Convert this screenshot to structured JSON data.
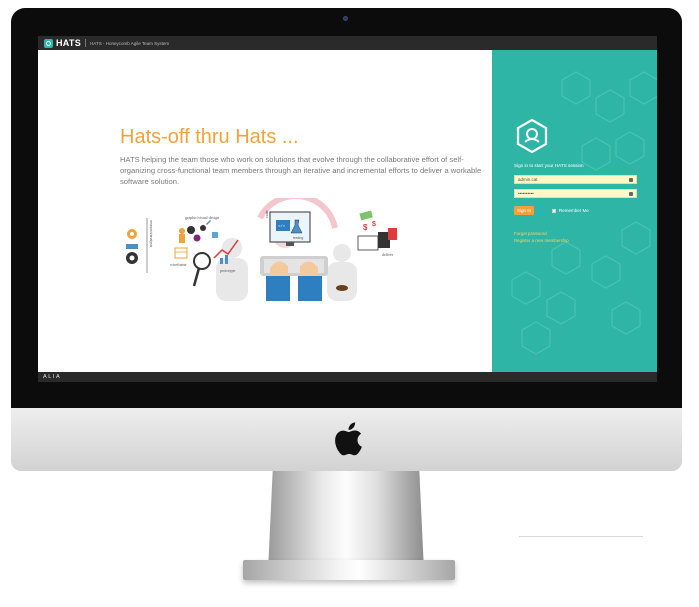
{
  "topbar": {
    "logo_text": "HATS",
    "subtitle": "HATS - Honeycomb Agile Team System"
  },
  "hero": {
    "title": "Hats-off thru Hats ...",
    "description": "HATS helping the team those who work on solutions that evolve through the collaborative effort of self-organizing cross-functional team members through an iterative and incremental efforts to deliver a workable software solution."
  },
  "illustration": {
    "labels": {
      "graphic": "graphic/visual design",
      "wireframe": "wireframe",
      "prototype": "prototype",
      "code": "code",
      "testing": "testing",
      "deliver": "deliver",
      "research": "research/analysis"
    }
  },
  "login": {
    "heading": "Sign in to start your HATS session",
    "username_value": "admin.cat",
    "password_value": "••••••••••",
    "signin_label": "Sign In",
    "remember_label": "Remember Me",
    "forgot_label": "Forgot password",
    "register_label": "Register a new membership"
  },
  "footer": {
    "logo": "ALIA"
  },
  "colors": {
    "accent_orange": "#f2a23c",
    "panel_teal": "#2fb5a6",
    "bezel": "#0c0c0c"
  }
}
